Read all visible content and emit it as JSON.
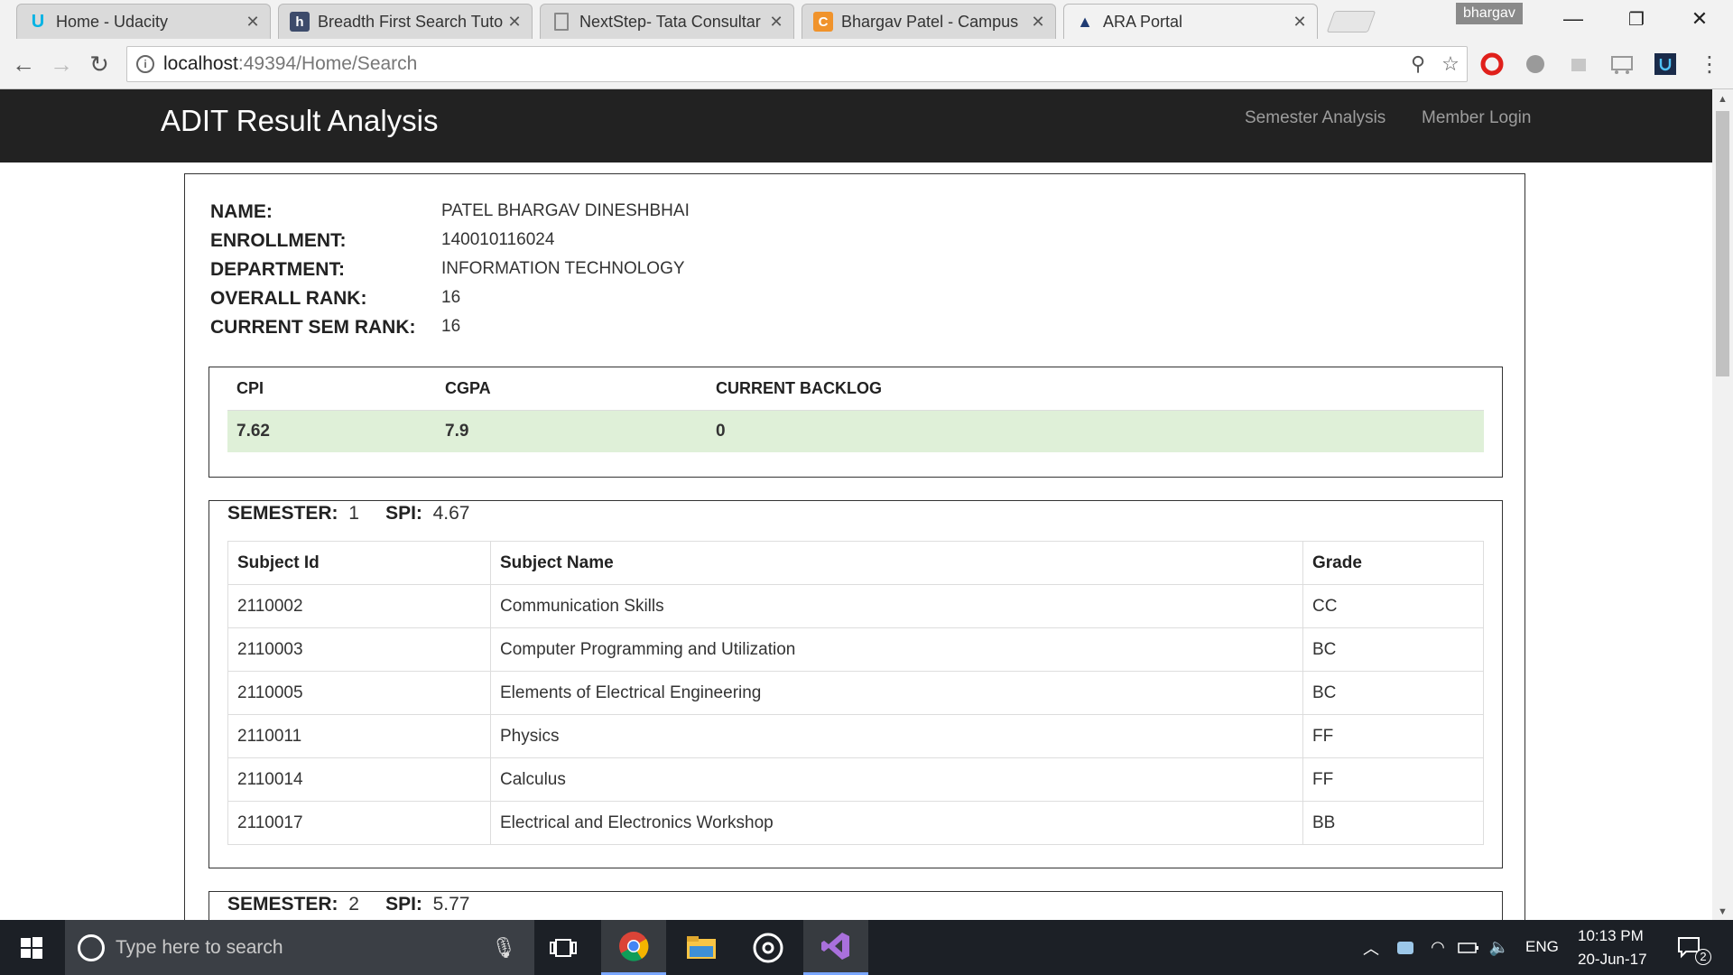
{
  "browser": {
    "tabs": [
      {
        "title": "Home - Udacity",
        "icon": "udacity-icon",
        "glyph": "U",
        "glyph_color": "#02b3e4",
        "glyph_bg": "transparent"
      },
      {
        "title": "Breadth First Search Tuto",
        "icon": "h-icon",
        "glyph": "h",
        "glyph_color": "#ffffff",
        "glyph_bg": "#3d4b6b"
      },
      {
        "title": "NextStep- Tata Consultar",
        "icon": "page-icon",
        "glyph": "▯",
        "glyph_color": "#777777",
        "glyph_bg": "transparent"
      },
      {
        "title": "Bhargav Patel - Campus",
        "icon": "campus-icon",
        "glyph": "C",
        "glyph_color": "#ffffff",
        "glyph_bg": "#f0932b"
      },
      {
        "title": "ARA Portal",
        "icon": "adit-logo-icon",
        "glyph": "▲",
        "glyph_color": "#1f3b73",
        "glyph_bg": "transparent"
      }
    ],
    "tab_close_glyph": "✕",
    "profile_name": "bhargav",
    "window_controls": {
      "minimize": "—",
      "restore": "❐",
      "close": "✕"
    },
    "nav": {
      "back": "←",
      "forward": "→",
      "reload": "↻"
    },
    "url_host": "localhost",
    "url_rest": ":49394/Home/Search",
    "info_glyph": "i",
    "zoom_glyph": "⚲",
    "star_glyph": "☆",
    "menu_glyph": "⋮"
  },
  "site": {
    "brand": "ADIT Result Analysis",
    "nav_links": [
      "Semester Analysis",
      "Member Login"
    ]
  },
  "student": {
    "fields": [
      {
        "label": "NAME:",
        "value": "PATEL BHARGAV DINESHBHAI"
      },
      {
        "label": "ENROLLMENT:",
        "value": "140010116024"
      },
      {
        "label": "DEPARTMENT:",
        "value": "INFORMATION TECHNOLOGY"
      },
      {
        "label": "OVERALL RANK:",
        "value": "16"
      },
      {
        "label": "CURRENT SEM RANK:",
        "value": "16"
      }
    ]
  },
  "summary": {
    "headers": [
      "CPI",
      "CGPA",
      "CURRENT BACKLOG"
    ],
    "values": [
      "7.62",
      "7.9",
      "0"
    ],
    "highlight_color": "#dff0d8"
  },
  "semesters": [
    {
      "semester_label": "SEMESTER:",
      "semester": "1",
      "spi_label": "SPI:",
      "spi": "4.67",
      "headers": [
        "Subject Id",
        "Subject Name",
        "Grade"
      ],
      "rows": [
        [
          "2110002",
          "Communication Skills",
          "CC"
        ],
        [
          "2110003",
          "Computer Programming and Utilization",
          "BC"
        ],
        [
          "2110005",
          "Elements of Electrical Engineering",
          "BC"
        ],
        [
          "2110011",
          "Physics",
          "FF"
        ],
        [
          "2110014",
          "Calculus",
          "FF"
        ],
        [
          "2110017",
          "Electrical and Electronics Workshop",
          "BB"
        ]
      ]
    },
    {
      "semester_label": "SEMESTER:",
      "semester": "2",
      "spi_label": "SPI:",
      "spi": "5.77"
    }
  ],
  "taskbar": {
    "search_placeholder": "Type here to search",
    "language": "ENG",
    "time": "10:13 PM",
    "date": "20-Jun-17",
    "notifications": "2"
  }
}
